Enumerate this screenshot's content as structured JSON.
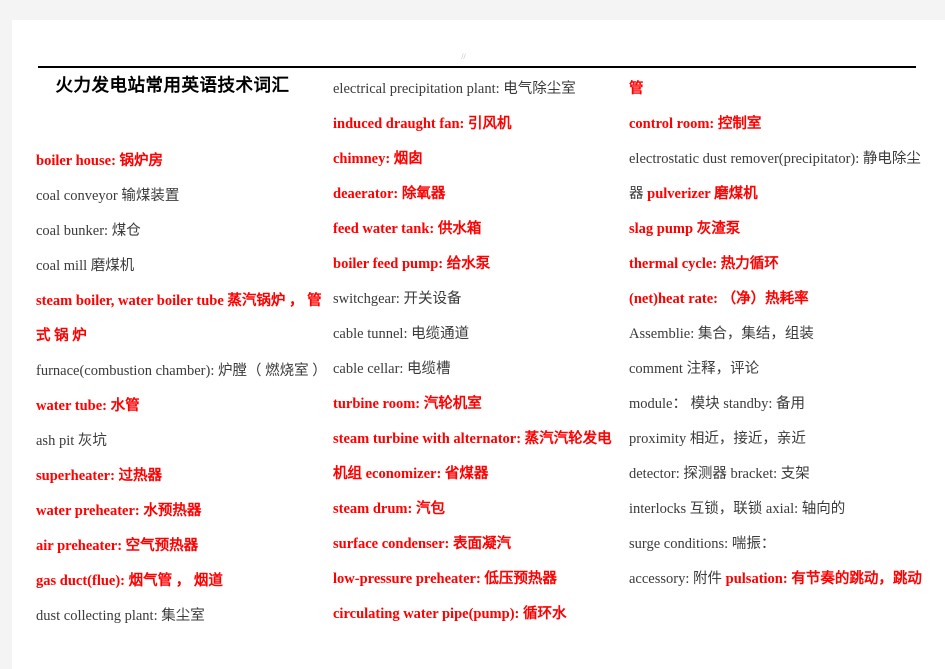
{
  "document": {
    "title": "火力发电站常用英语技术词汇",
    "page_mark": "//",
    "accent_color": "#ff0000",
    "text_color": "#3b3b3b",
    "page_background": "#ffffff",
    "viewer_background": "#f4f4f4"
  },
  "columns": [
    {
      "name": "column-1",
      "entries": [
        {
          "id": "boiler-house",
          "text": "boiler house:  锅炉房",
          "style": "red"
        },
        {
          "id": "coal-conveyor",
          "text": "coal conveyor  输煤装置",
          "style": "plain"
        },
        {
          "id": "coal-bunker",
          "text": "coal bunker:  煤仓",
          "style": "plain"
        },
        {
          "id": "coal-mill",
          "text": "coal mill 磨煤机",
          "style": "plain"
        },
        {
          "id": "steam-boiler",
          "text": "steam  boiler, water  boiler  tube  蒸汽锅炉 ， 管 式 锅 炉",
          "style": "red"
        },
        {
          "id": "furnace",
          "text": "furnace(combustion chamber):  炉膛（ 燃烧室 ）",
          "style": "plain"
        },
        {
          "id": "water-tube",
          "text": "water tube:  水管",
          "style": "red"
        },
        {
          "id": "ash-pit",
          "text": "ash pit  灰坑",
          "style": "plain"
        },
        {
          "id": "superheater",
          "text": "superheater:  过热器",
          "style": "red"
        },
        {
          "id": "water-preheater",
          "text": "water preheater:  水预热器",
          "style": "red"
        },
        {
          "id": "air-preheater",
          "text": "air preheater:  空气预热器",
          "style": "red"
        },
        {
          "id": "gas-duct",
          "text": "gas duct(flue):  烟气管 ， 烟道",
          "style": "red"
        },
        {
          "id": "dust-collecting",
          "text": "dust collecting plant:  集尘室",
          "style": "plain"
        }
      ]
    },
    {
      "name": "column-2",
      "entries": [
        {
          "id": "electrical-precipitation",
          "text": "electrical  precipitation  plant:  电气除尘室",
          "style": "plain"
        },
        {
          "id": "induced-draught-fan",
          "text": "induced draught fan:  引风机",
          "style": "red"
        },
        {
          "id": "chimney",
          "text": "chimney:  烟囱",
          "style": "red"
        },
        {
          "id": "deaerator",
          "text": "deaerator:  除氧器",
          "style": "red"
        },
        {
          "id": "feed-water-tank",
          "text": "feed water tank:  供水箱",
          "style": "red"
        },
        {
          "id": "boiler-feed-pump",
          "text": "boiler feed pump:  给水泵",
          "style": "red"
        },
        {
          "id": "switchgear",
          "text": "switchgear:  开关设备",
          "style": "plain"
        },
        {
          "id": "cable-tunnel",
          "text": "cable tunnel:  电缆通道",
          "style": "plain"
        },
        {
          "id": "cable-cellar",
          "text": "cable cellar:  电缆槽",
          "style": "plain"
        },
        {
          "id": "turbine-room",
          "text": "turbine room:  汽轮机室",
          "style": "red"
        },
        {
          "id": "steam-turbine-alternator",
          "text": "steam  turbine  with  alternator:  蒸汽汽轮发电机组 economizer:  省煤器",
          "style": "red"
        },
        {
          "id": "steam-drum",
          "text": "steam drum:  汽包",
          "style": "red"
        },
        {
          "id": "surface-condenser",
          "text": "surface condenser:  表面凝汽",
          "style": "red"
        },
        {
          "id": "low-pressure-preheater",
          "text": "low-pressure preheater:  低压预热器",
          "style": "red"
        },
        {
          "id": "circulating-water-pipe",
          "text": "circulating  water  pipe(pump):  循环水",
          "style": "red"
        }
      ]
    },
    {
      "name": "column-3",
      "entries": [
        {
          "id": "pipe-continuation",
          "text": "管",
          "style": "red"
        },
        {
          "id": "control-room",
          "text": "control room:  控制室",
          "style": "red"
        },
        {
          "id": "electrostatic-dust",
          "text": "electrostatic   dust   remover(precipitator):  静电除尘器 pulverizer  磨煤机",
          "style": "plain"
        },
        {
          "id": "slag-pump",
          "text": "slag pump  灰渣泵",
          "style": "red"
        },
        {
          "id": "thermal-cycle",
          "text": "thermal cycle:  热力循环",
          "style": "red"
        },
        {
          "id": "net-heat-rate",
          "text": "(net)heat rate:  （净）热耗率",
          "style": "red"
        },
        {
          "id": "assemblie",
          "text": "Assemblie:  集合，集结，组装",
          "style": "plain"
        },
        {
          "id": "comment",
          "text": "comment  注释，评论",
          "style": "plain"
        },
        {
          "id": "module-standby",
          "text": "module： 模块 standby:  备用",
          "style": "plain"
        },
        {
          "id": "proximity",
          "text": "proximity  相近，接近，亲近",
          "style": "plain"
        },
        {
          "id": "detector-bracket",
          "text": "detector:  探测器 bracket:  支架",
          "style": "plain"
        },
        {
          "id": "interlocks-axial",
          "text": "interlocks  互锁，联锁 axial:  轴向的",
          "style": "plain"
        },
        {
          "id": "surge-conditions",
          "text": "surge conditions:  喘振：",
          "style": "plain"
        },
        {
          "id": "accessory-pulsation",
          "text": "accessory:  附件 pulsation:  有节奏的跳动，跳动",
          "style": "plain"
        }
      ]
    }
  ]
}
